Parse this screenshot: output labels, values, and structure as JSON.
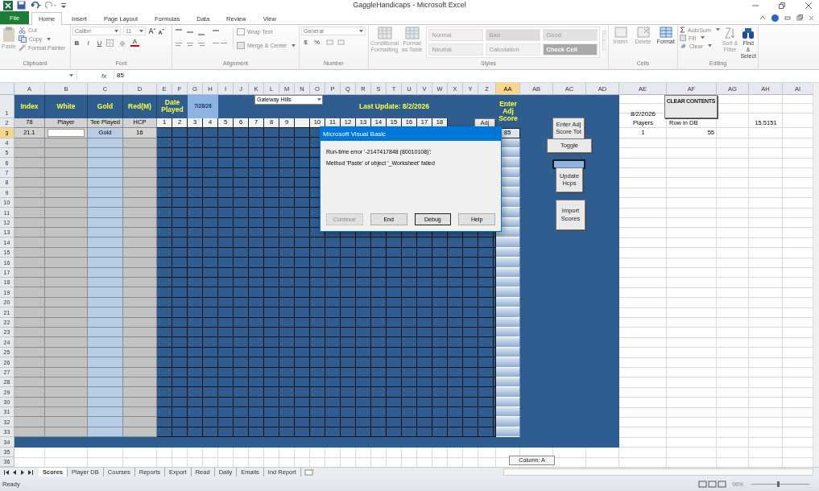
{
  "window": {
    "title": "GaggleHandicaps - Microsoft Excel"
  },
  "ribbon_tabs": [
    {
      "label": "File",
      "kind": "file",
      "selected": false
    },
    {
      "label": "Home",
      "kind": "tab",
      "selected": true
    },
    {
      "label": "Insert",
      "kind": "tab",
      "selected": false
    },
    {
      "label": "Page Layout",
      "kind": "tab",
      "selected": false
    },
    {
      "label": "Formulas",
      "kind": "tab",
      "selected": false
    },
    {
      "label": "Data",
      "kind": "tab",
      "selected": false
    },
    {
      "label": "Review",
      "kind": "tab",
      "selected": false
    },
    {
      "label": "View",
      "kind": "tab",
      "selected": false
    }
  ],
  "clipboard": {
    "label": "Clipboard",
    "paste": "Paste",
    "cut": "Cut",
    "copy": "Copy",
    "format_painter": "Format Painter"
  },
  "font": {
    "label": "Font",
    "family": "Calibri",
    "size": "11",
    "bold": "B",
    "italic": "I",
    "underline": "U",
    "font_color": "A"
  },
  "alignment": {
    "label": "Alignment",
    "wrap_text": "Wrap Text",
    "merge": "Merge & Center"
  },
  "number": {
    "label": "Number",
    "format": "General",
    "currency": "$",
    "percent": "%"
  },
  "styles": {
    "label": "Styles",
    "conditional": "Conditional Formatting",
    "format_table": "Format as Table",
    "gallery": [
      {
        "label": "Normal",
        "color": "#f4eef2"
      },
      {
        "label": "Bad",
        "color": "#e2dada"
      },
      {
        "label": "Good",
        "color": "#e2e2e2"
      },
      {
        "label": "Neutral",
        "color": "#efefef"
      },
      {
        "label": "Calculation",
        "color": "#f1f1f1"
      },
      {
        "label": "Check Cell",
        "color": "#a9a9a9"
      }
    ]
  },
  "cells_group": {
    "label": "Cells",
    "insert": "Insert",
    "delete": "Delete",
    "format": "Format"
  },
  "editing": {
    "label": "Editing",
    "autosum": "AutoSum",
    "fill": "Fill",
    "clear": "Clear",
    "sort": "Sort & Filter",
    "find": "Find & Select"
  },
  "formula_bar": {
    "fx": "fx",
    "value": "85"
  },
  "columns": [
    {
      "label": "A",
      "selected": false
    },
    {
      "label": "B",
      "selected": false
    },
    {
      "label": "C",
      "selected": false
    },
    {
      "label": "D",
      "selected": false
    },
    {
      "label": "E",
      "selected": false
    },
    {
      "label": "F",
      "selected": false
    },
    {
      "label": "G",
      "selected": false
    },
    {
      "label": "H",
      "selected": false
    },
    {
      "label": "I",
      "selected": false
    },
    {
      "label": "J",
      "selected": false
    },
    {
      "label": "K",
      "selected": false
    },
    {
      "label": "L",
      "selected": false
    },
    {
      "label": "M",
      "selected": false
    },
    {
      "label": "N",
      "selected": false
    },
    {
      "label": "O",
      "selected": false
    },
    {
      "label": "P",
      "selected": false
    },
    {
      "label": "Q",
      "selected": false
    },
    {
      "label": "R",
      "selected": false
    },
    {
      "label": "S",
      "selected": false
    },
    {
      "label": "T",
      "selected": false
    },
    {
      "label": "U",
      "selected": false
    },
    {
      "label": "V",
      "selected": false
    },
    {
      "label": "W",
      "selected": false
    },
    {
      "label": "X",
      "selected": false
    },
    {
      "label": "Y",
      "selected": false
    },
    {
      "label": "Z",
      "selected": false
    },
    {
      "label": "AA",
      "selected": true
    },
    {
      "label": "AB",
      "selected": false
    },
    {
      "label": "AC",
      "selected": false
    },
    {
      "label": "AD",
      "selected": false
    },
    {
      "label": "AE",
      "selected": false
    },
    {
      "label": "AF",
      "selected": false
    },
    {
      "label": "AG",
      "selected": false
    },
    {
      "label": "AH",
      "selected": false
    },
    {
      "label": "AI",
      "selected": false
    }
  ],
  "rows": [
    {
      "label": "1",
      "selected": false
    },
    {
      "label": "2",
      "selected": false
    },
    {
      "label": "3",
      "selected": true
    },
    {
      "label": "4",
      "selected": false
    },
    {
      "label": "5",
      "selected": false
    },
    {
      "label": "6",
      "selected": false
    },
    {
      "label": "7",
      "selected": false
    },
    {
      "label": "8",
      "selected": false
    },
    {
      "label": "9",
      "selected": false
    },
    {
      "label": "10",
      "selected": false
    },
    {
      "label": "11",
      "selected": false
    },
    {
      "label": "12",
      "selected": false
    },
    {
      "label": "13",
      "selected": false
    },
    {
      "label": "14",
      "selected": false
    },
    {
      "label": "15",
      "selected": false
    },
    {
      "label": "16",
      "selected": false
    },
    {
      "label": "17",
      "selected": false
    },
    {
      "label": "18",
      "selected": false
    },
    {
      "label": "19",
      "selected": false
    },
    {
      "label": "20",
      "selected": false
    },
    {
      "label": "21",
      "selected": false
    },
    {
      "label": "22",
      "selected": false
    },
    {
      "label": "23",
      "selected": false
    },
    {
      "label": "24",
      "selected": false
    },
    {
      "label": "25",
      "selected": false
    },
    {
      "label": "26",
      "selected": false
    },
    {
      "label": "27",
      "selected": false
    },
    {
      "label": "28",
      "selected": false
    },
    {
      "label": "29",
      "selected": false
    },
    {
      "label": "30",
      "selected": false
    },
    {
      "label": "31",
      "selected": false
    },
    {
      "label": "32",
      "selected": false
    },
    {
      "label": "33",
      "selected": false
    },
    {
      "label": "34",
      "selected": false
    },
    {
      "label": "35",
      "selected": false
    },
    {
      "label": "36",
      "selected": false
    }
  ],
  "row_1_cells": [
    "Index",
    "White",
    "Gold",
    "Red(M)",
    "Date Played",
    "7/28/26",
    "Last Update:   8/2/2026",
    "Enter Adj Score",
    "8/2/2026"
  ],
  "row_2_cells": [
    "78",
    "Player",
    "Tee Played",
    "HCP",
    "1",
    "2",
    "3",
    "4",
    "5",
    "6",
    "7",
    "8",
    "9",
    "10",
    "11",
    "12",
    "13",
    "14",
    "15",
    "16",
    "17",
    "18",
    "Players",
    "Row in DB",
    "15.5151"
  ],
  "row_3_cells": [
    "21.1",
    "Gold",
    "16",
    "85",
    "1",
    "55"
  ],
  "sheet_controls": [
    {
      "kind": "button",
      "label": "CLEAR CONTENTS"
    },
    {
      "kind": "button",
      "label": "Adj"
    },
    {
      "kind": "button",
      "label": "Enter Adj Score Tot"
    },
    {
      "kind": "button",
      "label": "Toggle"
    },
    {
      "kind": "shape"
    },
    {
      "kind": "button",
      "label": "Update Hcps"
    },
    {
      "kind": "button",
      "label": "Import Scores"
    },
    {
      "kind": "dropdown",
      "label": "Gateway Hills"
    }
  ],
  "tooltip": "Column: A",
  "dialog": {
    "title": "Microsoft Visual Basic",
    "message": "Run-time error '-2147417848 (80010108)':",
    "detail": "Method 'Paste' of object '_Worksheet' failed",
    "buttons": [
      {
        "label": "Continue",
        "disabled": true,
        "default": false
      },
      {
        "label": "End",
        "disabled": false,
        "default": false
      },
      {
        "label": "Debug",
        "disabled": false,
        "default": true
      },
      {
        "label": "Help",
        "disabled": false,
        "default": false
      }
    ]
  },
  "sheet_tabs": [
    {
      "label": "Scores",
      "selected": true
    },
    {
      "label": "Player DB",
      "selected": false
    },
    {
      "label": "Courses",
      "selected": false
    },
    {
      "label": "Reports",
      "selected": false
    },
    {
      "label": "Export",
      "selected": false
    },
    {
      "label": "Read",
      "selected": false
    },
    {
      "label": "Daily",
      "selected": false
    },
    {
      "label": "Emails",
      "selected": false
    },
    {
      "label": "Ind Report",
      "selected": false
    }
  ],
  "status_bar": {
    "text": "Ready",
    "zoom": "96%",
    "zoom_slider": {
      "level": 0.46
    }
  }
}
